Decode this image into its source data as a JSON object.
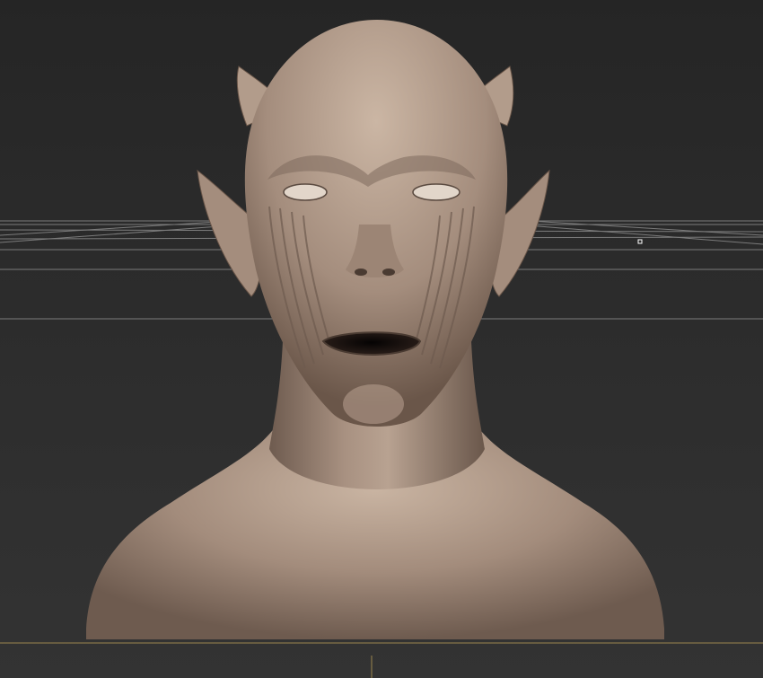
{
  "viewport": {
    "background_top": "#252525",
    "background_bottom": "#333333",
    "grid_color": "#8a8a8a",
    "skin_color": "#a38c7c",
    "skin_highlight": "#c9b4a2",
    "skin_shadow": "#5a4a40",
    "mouth_color": "#141010",
    "axis_color": "#c8a85a"
  },
  "model": {
    "icon": "sculpt-head-mesh"
  }
}
